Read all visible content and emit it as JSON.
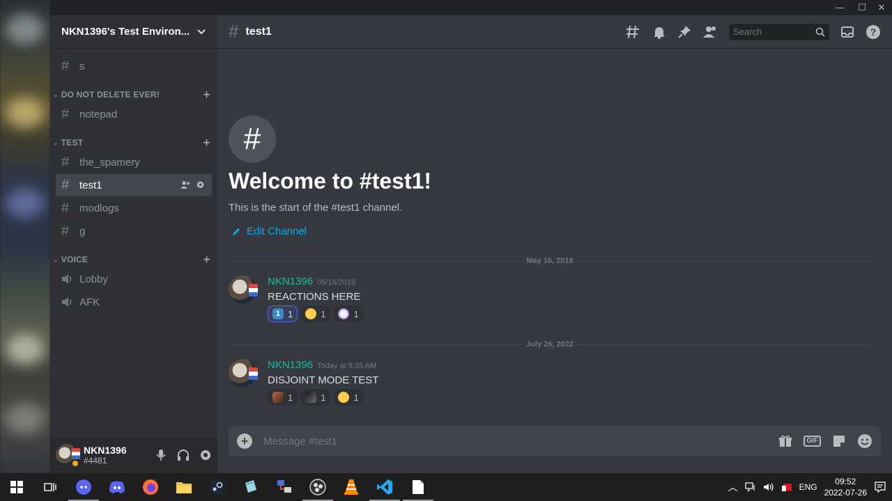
{
  "window": {
    "min": "—",
    "max": "☐",
    "close": "✕"
  },
  "server": {
    "name": "NKN1396's Test Environ..."
  },
  "channels": {
    "top": [
      {
        "name": "s"
      }
    ],
    "categories": [
      {
        "name": "DO NOT DELETE EVER!",
        "items": [
          {
            "name": "notepad"
          }
        ]
      },
      {
        "name": "TEST",
        "items": [
          {
            "name": "the_spamery"
          },
          {
            "name": "test1",
            "active": true
          },
          {
            "name": "modlogs"
          },
          {
            "name": "g"
          }
        ]
      },
      {
        "name": "VOICE",
        "items": [
          {
            "name": "Lobby",
            "voice": true
          },
          {
            "name": "AFK",
            "voice": true
          }
        ]
      }
    ]
  },
  "user": {
    "name": "NKN1396",
    "discriminator": "#4481",
    "status_color": "#faa61a"
  },
  "header": {
    "channel": "test1",
    "search_placeholder": "Search"
  },
  "welcome": {
    "title": "Welcome to #test1!",
    "subtitle": "This is the start of the #test1 channel.",
    "edit_label": "Edit Channel"
  },
  "messages": [
    {
      "divider": "May 16, 2018",
      "author": "NKN1396",
      "timestamp": "05/16/2018",
      "text": "REACTIONS HERE",
      "reactions": [
        {
          "emoji": "keycap-one",
          "count": "1",
          "me": true
        },
        {
          "emoji": "thinking-face",
          "count": "1",
          "me": false
        },
        {
          "emoji": "custom-emoji",
          "count": "1",
          "me": false
        }
      ]
    },
    {
      "divider": "July 26, 2022",
      "author": "NKN1396",
      "timestamp": "Today at 9:35 AM",
      "text": "DISJOINT MODE TEST",
      "reactions": [
        {
          "emoji": "custom-emoji-a",
          "count": "1",
          "me": false
        },
        {
          "emoji": "custom-emoji-b",
          "count": "1",
          "me": false
        },
        {
          "emoji": "slightly-smiling-face",
          "count": "1",
          "me": false
        }
      ]
    }
  ],
  "composer": {
    "placeholder": "Message #test1",
    "gif_label": "GIF"
  },
  "taskbar": {
    "apps": [
      "start",
      "task-view",
      "discord-canary",
      "discord",
      "firefox",
      "file-explorer",
      "steam",
      "notepad-plus",
      "network-tool",
      "obs",
      "vlc",
      "vscode",
      "notepad"
    ],
    "lang": "ENG",
    "time": "09:52",
    "date": "2022-07-26"
  },
  "colors": {
    "accent": "#5865f2",
    "author": "#1abc9c",
    "link": "#00aff4"
  }
}
